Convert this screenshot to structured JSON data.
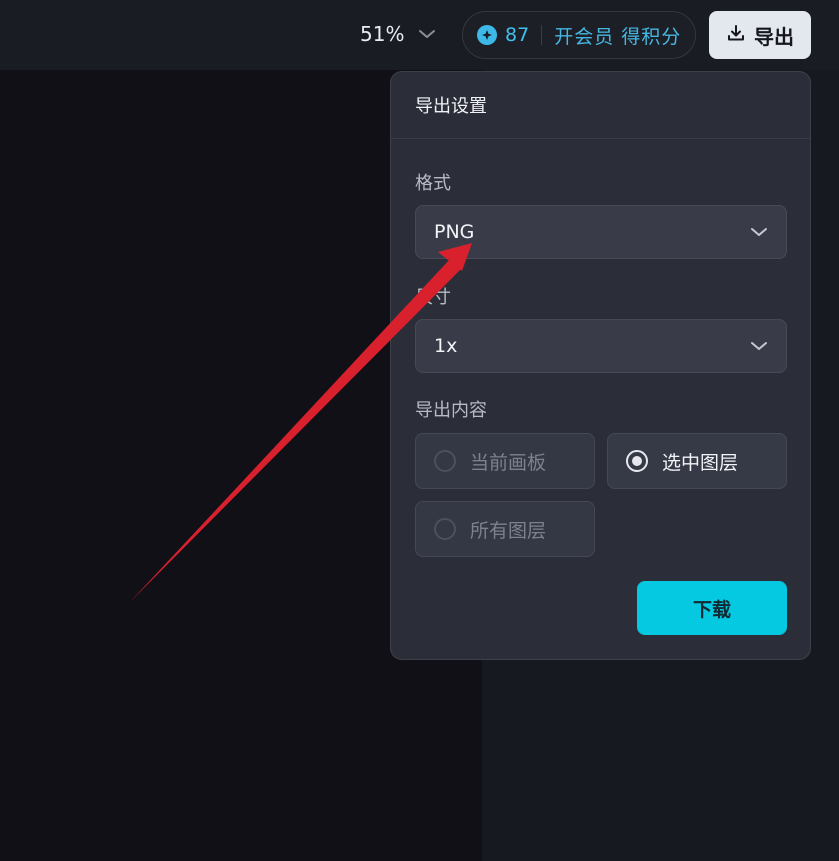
{
  "toolbar": {
    "zoom_level": "51%",
    "points": "87",
    "member_link": "开会员 得积分",
    "export_label": "导出"
  },
  "export_panel": {
    "title": "导出设置",
    "format_label": "格式",
    "format_value": "PNG",
    "size_label": "尺寸",
    "size_value": "1x",
    "content_label": "导出内容",
    "content_options": [
      {
        "label": "当前画板",
        "state": "disabled"
      },
      {
        "label": "选中图层",
        "state": "selected"
      },
      {
        "label": "所有图层",
        "state": "disabled"
      }
    ],
    "download_label": "下载"
  },
  "colors": {
    "accent": "#04c9e0",
    "points_blue": "#3fc0ef",
    "annotation_arrow": "#d9212e"
  },
  "icons": [
    "chevron-down-icon",
    "star-coin-icon",
    "download-icon",
    "radio-icon",
    "annotation-arrow"
  ]
}
